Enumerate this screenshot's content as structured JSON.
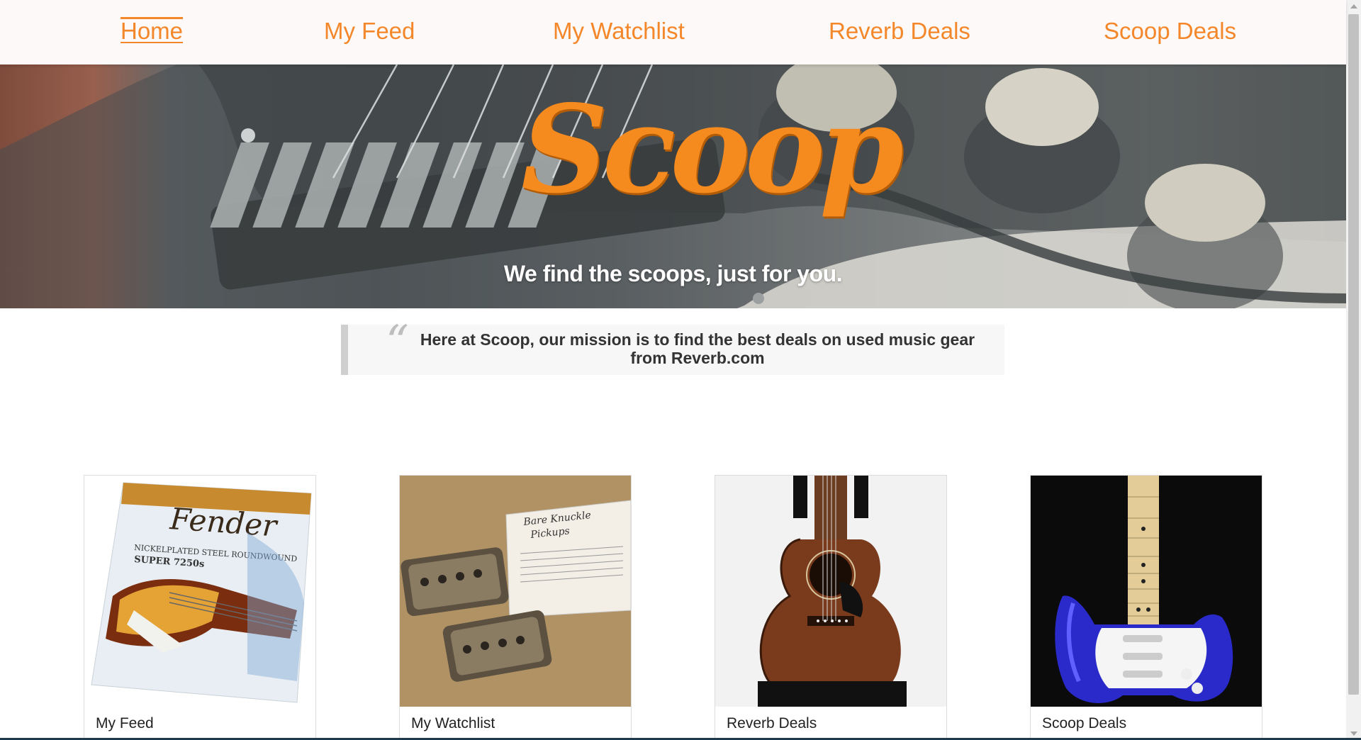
{
  "nav": {
    "items": [
      {
        "label": "Home",
        "active": true
      },
      {
        "label": "My Feed",
        "active": false
      },
      {
        "label": "My Watchlist",
        "active": false
      },
      {
        "label": "Reverb Deals",
        "active": false
      },
      {
        "label": "Scoop Deals",
        "active": false
      }
    ]
  },
  "hero": {
    "logo": "Scoop",
    "tagline": "We find the scoops, just for you."
  },
  "mission": {
    "quote_mark": "“",
    "text": "Here at Scoop, our mission is to find the best deals on used music gear from Reverb.com"
  },
  "cards": [
    {
      "caption": "My Feed",
      "image": "fender-bass-strings-package"
    },
    {
      "caption": "My Watchlist",
      "image": "bare-knuckle-pickups"
    },
    {
      "caption": "Reverb Deals",
      "image": "acoustic-guitar"
    },
    {
      "caption": "Scoop Deals",
      "image": "blue-stratocaster-guitar"
    }
  ],
  "colors": {
    "accent": "#f4872a",
    "nav_bg": "#fdf9f8",
    "quote_bg": "#f7f7f7"
  }
}
